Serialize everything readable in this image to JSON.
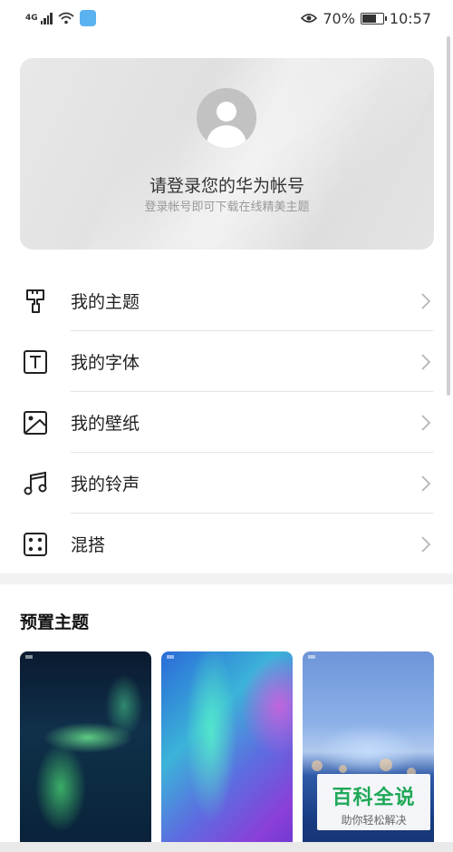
{
  "status_bar": {
    "network": "4G",
    "battery_percent": "70%",
    "time": "10:57",
    "icons": [
      "signal-icon",
      "wifi-icon",
      "app-notification-icon",
      "eye-comfort-icon",
      "battery-icon"
    ]
  },
  "account": {
    "title": "请登录您的华为帐号",
    "subtitle": "登录帐号即可下载在线精美主题"
  },
  "menu": [
    {
      "label": "我的主题",
      "icon": "brush-icon"
    },
    {
      "label": "我的字体",
      "icon": "font-icon"
    },
    {
      "label": "我的壁纸",
      "icon": "wallpaper-icon"
    },
    {
      "label": "我的铃声",
      "icon": "music-note-icon"
    },
    {
      "label": "混搭",
      "icon": "dice-icon"
    }
  ],
  "preset_section": {
    "title": "预置主题",
    "themes": [
      "aurora",
      "gradient",
      "bokeh"
    ]
  },
  "watermark": {
    "main": "百科全说",
    "sub": "助你轻松解决"
  },
  "colors": {
    "watermark_green": "#1fa857",
    "card_grey": "#e4e4e4"
  }
}
